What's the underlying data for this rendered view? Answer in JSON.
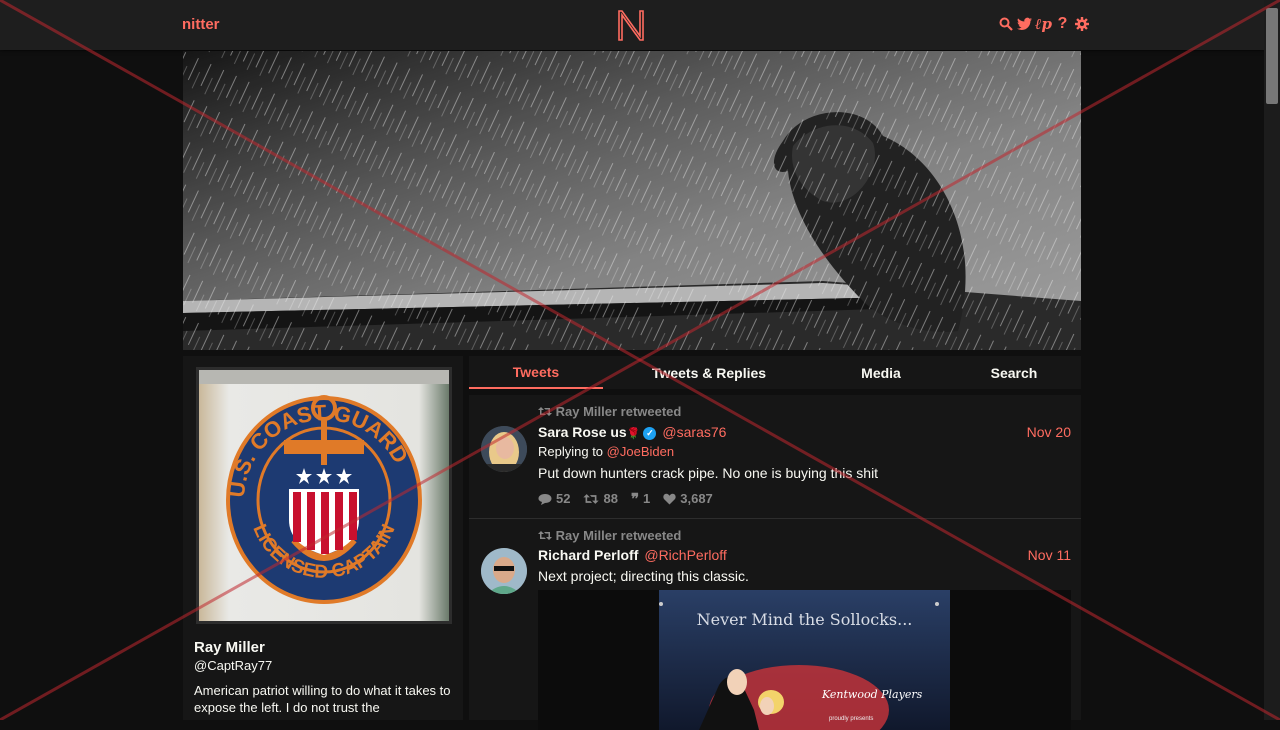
{
  "brand": "nitter",
  "logo_letter": "N",
  "nav_icons": [
    "search-icon",
    "twitter-bird-icon",
    "rss-icon",
    "help-icon",
    "gear-icon"
  ],
  "accent_color": "#ff6c60",
  "profile": {
    "fullname": "Ray Miller",
    "username": "@CaptRay77",
    "bio": "American patriot willing to do what it takes to expose the left. I do not trust the",
    "avatar_text_top": "U.S. COAST GUARD",
    "avatar_text_bottom": "LICENSED CAPTAIN"
  },
  "tabs": [
    {
      "label": "Tweets",
      "active": true
    },
    {
      "label": "Tweets & Replies",
      "active": false
    },
    {
      "label": "Media",
      "active": false
    },
    {
      "label": "Search",
      "active": false
    }
  ],
  "tweets": [
    {
      "retweet_header": "Ray Miller retweeted",
      "fullname": "Sara Rose us",
      "emoji": "🌹",
      "verified": true,
      "username": "@saras76",
      "date": "Nov 20",
      "replying_label": "Replying to",
      "replying_to": "@JoeBiden",
      "text": "Put down hunters crack pipe. No one is buying this shit",
      "stats": {
        "replies": "52",
        "retweets": "88",
        "quotes": "1",
        "likes": "3,687"
      }
    },
    {
      "retweet_header": "Ray Miller retweeted",
      "fullname": "Richard Perloff",
      "verified": false,
      "username": "@RichPerloff",
      "date": "Nov 11",
      "text": "Next project; directing this classic.",
      "media_title": "Never Mind the Sollocks...",
      "media_logo": "Kentwood Players",
      "media_subtitle": "proudly presents"
    }
  ]
}
